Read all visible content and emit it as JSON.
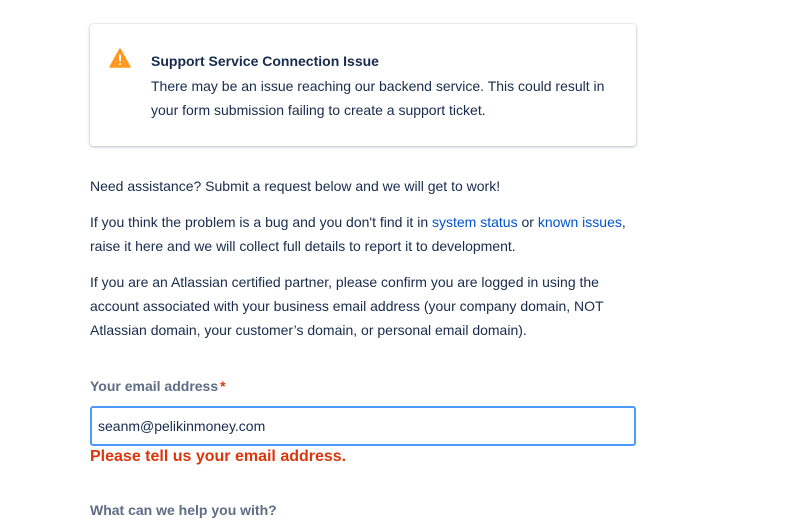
{
  "alert": {
    "icon": "warning-icon",
    "icon_color": "#ff991f",
    "title": "Support Service Connection Issue",
    "body": "There may be an issue reaching our backend service. This could result in your form submission failing to create a support ticket."
  },
  "intro": {
    "line1": "Need assistance? Submit a request below and we will get to work!",
    "line2_prefix": "If you think the problem is a bug and you don't find it in ",
    "system_status_link": "system status",
    "line2_or": " or ",
    "known_issues_link": "known issues",
    "line2_suffix": ", raise it here and we will collect full details to report it to development.",
    "line3": "If you are an Atlassian certified partner, please confirm you are logged in using the account associated with your business email address (your company domain, NOT Atlassian domain, your customer’s domain, or personal email domain)."
  },
  "email_field": {
    "label": "Your email address",
    "required_marker": "*",
    "value": "seanm@pelikinmoney.com",
    "error": "Please tell us your email address."
  },
  "help_field": {
    "label": "What can we help you with?"
  },
  "colors": {
    "link": "#0052cc",
    "error": "#de350b",
    "focus_border": "#4c9aff",
    "text": "#172b4d"
  }
}
